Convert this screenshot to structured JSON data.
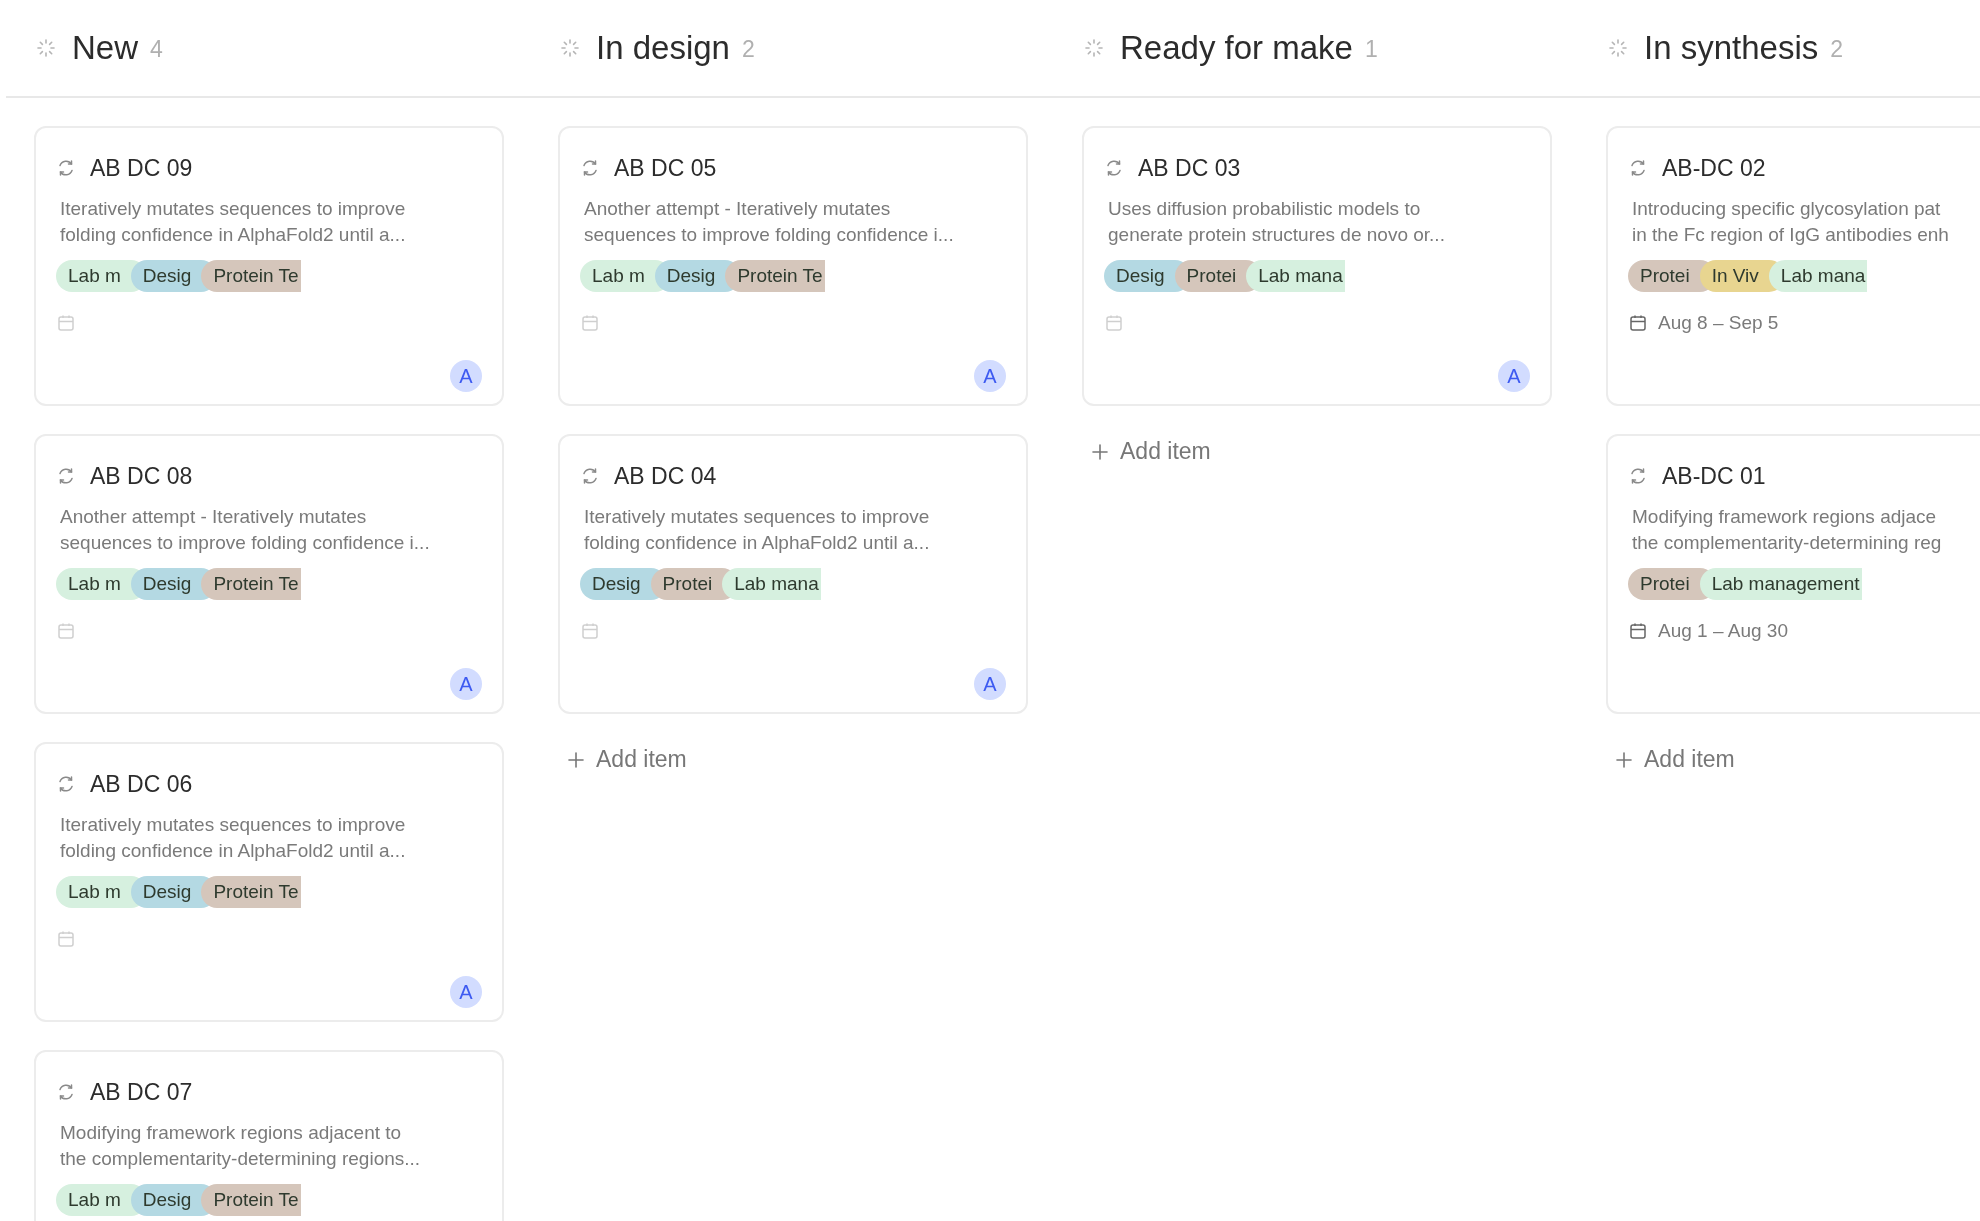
{
  "columns": [
    {
      "title": "New",
      "count": "4",
      "cards": [
        {
          "kind": "unscheduled",
          "title": "AB DC 09",
          "description": [
            "Iteratively mutates sequences to improve",
            "folding confidence in AlphaFold2 until a..."
          ],
          "tags": [
            {
              "label": "Lab m",
              "color": "#d6f0df"
            },
            {
              "label": "Desig",
              "color": "#b4d9e3"
            },
            {
              "label": "Protein Te",
              "color": "#d5c6bb"
            }
          ],
          "assignee": "A"
        },
        {
          "kind": "unscheduled",
          "title": "AB DC 08",
          "description": [
            "Another attempt - Iteratively mutates",
            "sequences to improve folding confidence i..."
          ],
          "tags": [
            {
              "label": "Lab m",
              "color": "#d6f0df"
            },
            {
              "label": "Desig",
              "color": "#b4d9e3"
            },
            {
              "label": "Protein Te",
              "color": "#d5c6bb"
            }
          ],
          "assignee": "A"
        },
        {
          "kind": "unscheduled",
          "title": "AB DC 06",
          "description": [
            "Iteratively mutates sequences to improve",
            "folding confidence in AlphaFold2 until a..."
          ],
          "tags": [
            {
              "label": "Lab m",
              "color": "#d6f0df"
            },
            {
              "label": "Desig",
              "color": "#b4d9e3"
            },
            {
              "label": "Protein Te",
              "color": "#d5c6bb"
            }
          ],
          "assignee": "A"
        },
        {
          "kind": "partial",
          "title": "AB DC 07",
          "description": [
            "Modifying framework regions adjacent to",
            "the complementarity-determining regions..."
          ],
          "tags": [
            {
              "label": "Lab m",
              "color": "#d6f0df"
            },
            {
              "label": "Desig",
              "color": "#b4d9e3"
            },
            {
              "label": "Protein Te",
              "color": "#d5c6bb"
            }
          ]
        }
      ]
    },
    {
      "title": "In design",
      "count": "2",
      "cards": [
        {
          "kind": "unscheduled",
          "title": "AB DC 05",
          "description": [
            "Another attempt - Iteratively mutates",
            "sequences to improve folding confidence i..."
          ],
          "tags": [
            {
              "label": "Lab m",
              "color": "#d6f0df"
            },
            {
              "label": "Desig",
              "color": "#b4d9e3"
            },
            {
              "label": "Protein Te",
              "color": "#d5c6bb"
            }
          ],
          "assignee": "A"
        },
        {
          "kind": "unscheduled",
          "title": "AB DC 04",
          "description": [
            "Iteratively mutates sequences to improve",
            "folding confidence in AlphaFold2 until a..."
          ],
          "tags": [
            {
              "label": "Desig",
              "color": "#b4d9e3"
            },
            {
              "label": "Protei",
              "color": "#d5c6bb"
            },
            {
              "label": "Lab mana",
              "color": "#d6f0df"
            }
          ],
          "assignee": "A"
        }
      ],
      "add_item": "Add item"
    },
    {
      "title": "Ready for make",
      "count": "1",
      "cards": [
        {
          "kind": "unscheduled",
          "title": "AB DC 03",
          "description": [
            "Uses diffusion probabilistic models to",
            "generate protein structures de novo or..."
          ],
          "tags": [
            {
              "label": "Desig",
              "color": "#b4d9e3"
            },
            {
              "label": "Protei",
              "color": "#d5c6bb"
            },
            {
              "label": "Lab mana",
              "color": "#d6f0df"
            }
          ],
          "assignee": "A"
        }
      ],
      "add_item": "Add item"
    },
    {
      "title": "In synthesis",
      "count": "2",
      "cards": [
        {
          "kind": "scheduled",
          "title": "AB-DC 02",
          "description": [
            "Introducing specific glycosylation pat",
            "in the Fc region of IgG antibodies enh"
          ],
          "tags": [
            {
              "label": "Protei",
              "color": "#d5c6bb"
            },
            {
              "label": "In Viv",
              "color": "#e8d590"
            },
            {
              "label": "Lab mana",
              "color": "#d6f0df"
            }
          ],
          "date": "Aug 8 – Sep 5"
        },
        {
          "kind": "scheduled",
          "title": "AB-DC 01",
          "description": [
            "Modifying framework regions adjace",
            "the complementarity-determining reg"
          ],
          "tags": [
            {
              "label": "Protei",
              "color": "#d5c6bb"
            },
            {
              "label": "Lab management",
              "color": "#d6f0df"
            }
          ],
          "date": "Aug 1 – Aug 30"
        }
      ],
      "add_item": "Add item"
    }
  ]
}
